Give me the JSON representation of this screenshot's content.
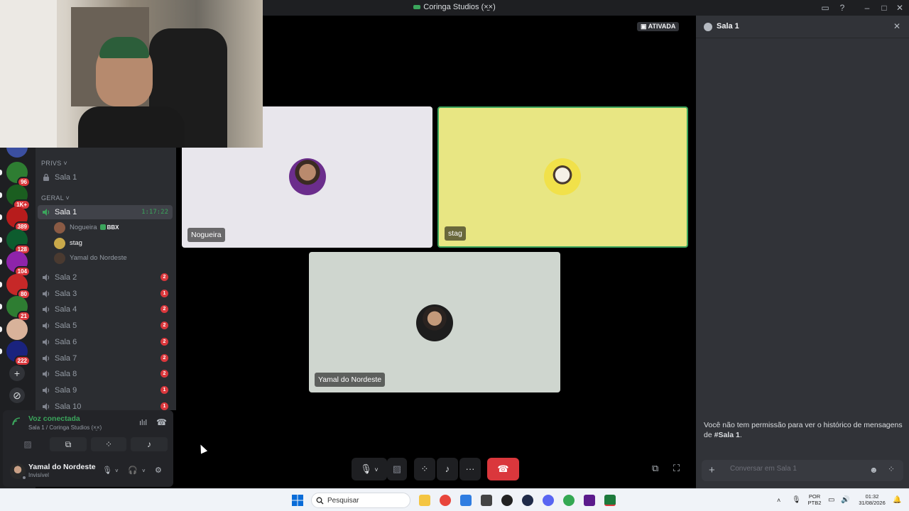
{
  "window": {
    "title": "Coringa Studios (×̫×)"
  },
  "servers": [
    {
      "badge": "96",
      "color": "#2e7d32"
    },
    {
      "badge": "1K+",
      "color": "#1b5e20"
    },
    {
      "badge": "389",
      "color": "#b71c1c"
    },
    {
      "badge": "128",
      "color": "#0d5c2e"
    },
    {
      "badge": "104",
      "color": "#8e24aa"
    },
    {
      "badge": "80",
      "color": "#c62828"
    },
    {
      "badge": "21",
      "color": "#2e7d32"
    },
    {
      "badge": "",
      "color": "#d8b29a"
    },
    {
      "badge": "222",
      "color": "#1a237e"
    }
  ],
  "channels": {
    "category_privs": "PRIVs",
    "priv_channel": "Sala 1",
    "category_geral": "GERAL",
    "active_channel": {
      "label": "Sala 1",
      "timer": "1:17:22"
    },
    "voice_users": [
      {
        "name": "Nogueira",
        "tag": "BBX"
      },
      {
        "name": "stag"
      },
      {
        "name": "Yamal do Nordeste"
      }
    ],
    "others": [
      {
        "label": "Sala 2",
        "count": "2"
      },
      {
        "label": "Sala 3",
        "count": "1"
      },
      {
        "label": "Sala 4",
        "count": "2"
      },
      {
        "label": "Sala 5",
        "count": "2"
      },
      {
        "label": "Sala 6",
        "count": "2"
      },
      {
        "label": "Sala 7",
        "count": "2"
      },
      {
        "label": "Sala 8",
        "count": "2"
      },
      {
        "label": "Sala 9",
        "count": "1"
      },
      {
        "label": "Sala 10",
        "count": "1"
      }
    ]
  },
  "voice": {
    "status": "Voz conectada",
    "location": "Sala 1 / Coringa Studios (×̫×)"
  },
  "user": {
    "name": "Yamal do Nordeste",
    "status": "Invisível"
  },
  "stage": {
    "status_badge": "ATIVADA",
    "tiles": [
      {
        "name": "Nogueira",
        "bg": "#e8e6ec",
        "speaking": false
      },
      {
        "name": "stag",
        "bg": "#e8e683",
        "speaking": true
      },
      {
        "name": "Yamal do Nordeste",
        "bg": "#cfd6cf",
        "speaking": false
      }
    ]
  },
  "chat": {
    "title": "Sala 1",
    "no_permission_prefix": "Você não tem permissão para ver o histórico de mensagens de ",
    "no_permission_channel": "#Sala 1",
    "no_permission_suffix": ".",
    "input_placeholder": "Conversar em Sala 1"
  },
  "taskbar": {
    "search_label": "Pesquisar",
    "lang_top": "POR",
    "lang_bottom": "PTB2",
    "time": "01:32",
    "date": "31/08/2026"
  },
  "colors": {
    "accent_green": "#3ba55c",
    "danger": "#da373c",
    "bg_dark": "#1e1f22"
  }
}
